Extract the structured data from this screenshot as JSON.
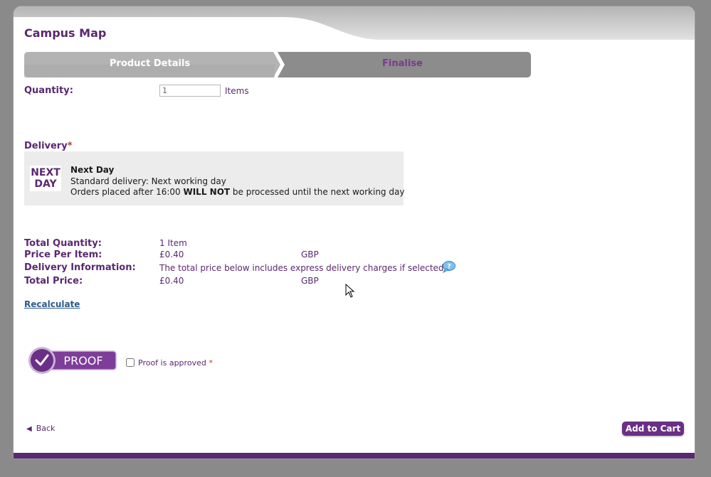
{
  "page": {
    "title": "Campus Map"
  },
  "steps": [
    {
      "label": "Product Details"
    },
    {
      "label": "Finalise"
    }
  ],
  "quantity": {
    "label": "Quantity:",
    "value": "1",
    "unit": "Items"
  },
  "delivery": {
    "label": "Delivery",
    "required_mark": "*",
    "option": {
      "logo_line1": "NEXT",
      "logo_line2": "DAY",
      "title": "Next Day",
      "line1": "Standard delivery: Next working day",
      "line2_before": "Orders placed after 16:00 ",
      "line2_bold": "WILL NOT",
      "line2_after": " be processed until the next working day"
    }
  },
  "summary": {
    "total_quantity_label": "Total Quantity:",
    "total_quantity_value": "1 Item",
    "price_per_item_label": "Price Per Item:",
    "price_per_item_value": "£0.40",
    "price_per_item_currency": "GBP",
    "delivery_info_label": "Delivery Information:",
    "delivery_info_value": "The total price below includes express delivery charges if selected.",
    "total_price_label": "Total Price:",
    "total_price_value": "£0.40",
    "total_price_currency": "GBP"
  },
  "actions": {
    "recalculate": "Recalculate",
    "back": "Back",
    "add_to_cart": "Add to Cart"
  },
  "proof": {
    "badge_text": "PROOF",
    "checkbox_label": "Proof is approved",
    "required_mark": "*",
    "checked": false
  },
  "icons": {
    "help": "help-speech-bubble-icon",
    "back_arrow": "left-triangle-icon",
    "proof_check": "checkmark-icon",
    "cursor": "mouse-pointer-icon"
  },
  "colors": {
    "brand": "#5a2870",
    "button": "#6a2f86",
    "link": "#2b5c8a",
    "required": "#c0392b"
  }
}
